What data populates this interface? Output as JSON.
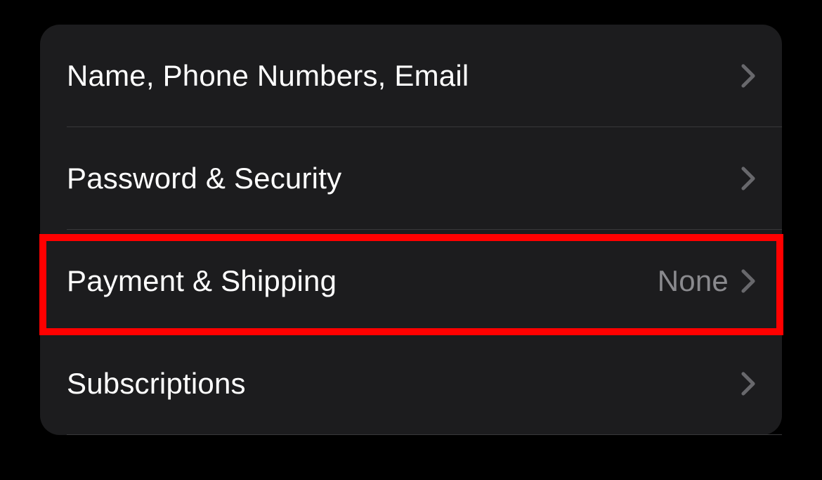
{
  "settings": {
    "rows": [
      {
        "label": "Name, Phone Numbers, Email",
        "value": null,
        "highlighted": false
      },
      {
        "label": "Password & Security",
        "value": null,
        "highlighted": false
      },
      {
        "label": "Payment & Shipping",
        "value": "None",
        "highlighted": true
      },
      {
        "label": "Subscriptions",
        "value": null,
        "highlighted": false
      }
    ]
  },
  "colors": {
    "background": "#000000",
    "groupBackground": "#1c1c1e",
    "text": "#ffffff",
    "secondaryText": "#8a8a8e",
    "separator": "#38383a",
    "highlight": "#ff0000"
  }
}
